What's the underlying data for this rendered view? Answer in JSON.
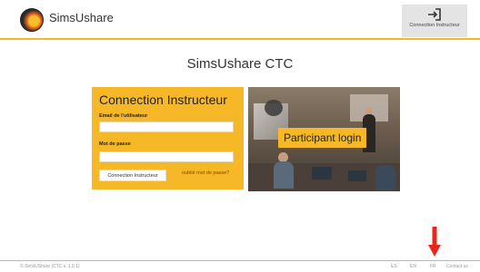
{
  "header": {
    "brand": "SimsUshare",
    "instructor_button": "Connection Instructeur"
  },
  "main": {
    "title": "SimsUshare CTC",
    "login": {
      "heading": "Connection Instructeur",
      "email_label": "Email de l'utilisateur",
      "email_value": "",
      "password_label": "Mot de passe",
      "password_value": "",
      "submit": "Connection Instructeur",
      "forgot": "oublié mot de passe?"
    },
    "participant": {
      "label": "Participant login"
    }
  },
  "footer": {
    "copyright": "© SimsUShare (CTC v. 1.0.1)",
    "languages": [
      "ES",
      "EN",
      "FR"
    ],
    "contact": "Contact us"
  },
  "colors": {
    "accent": "#f6b827",
    "arrow": "#e8241b"
  },
  "icons": {
    "instructor": "sign-in-icon",
    "annotation": "arrow-down-icon"
  }
}
